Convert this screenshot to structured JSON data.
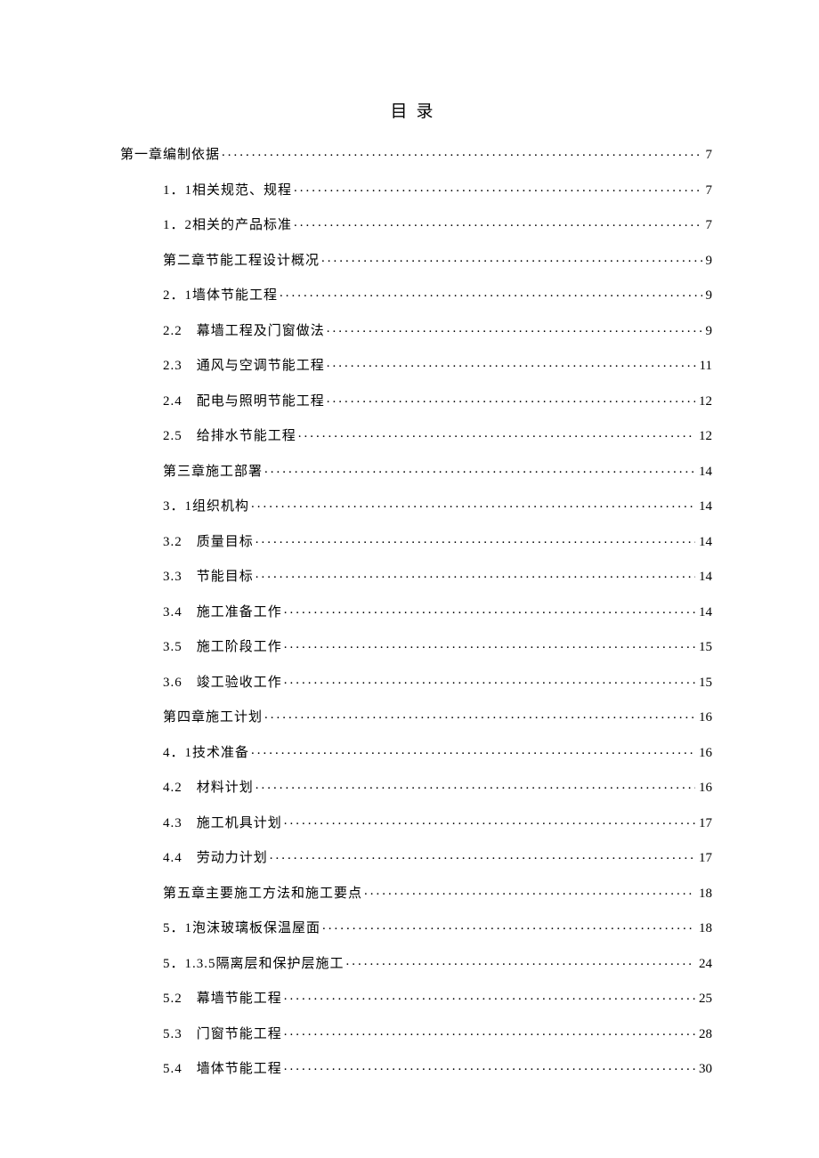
{
  "title": "目录",
  "toc": [
    {
      "level": 0,
      "label": "第一章编制依据",
      "page": "7"
    },
    {
      "level": 1,
      "label": "1．1相关规范、规程",
      "page": "7"
    },
    {
      "level": 1,
      "label": "1．2相关的产品标准",
      "page": "7"
    },
    {
      "level": 1,
      "label": "第二章节能工程设计概况",
      "page": "9"
    },
    {
      "level": 1,
      "label": "2．1墙体节能工程",
      "page": "9"
    },
    {
      "level": 1,
      "label": "2.2　幕墙工程及门窗做法",
      "page": "9"
    },
    {
      "level": 1,
      "label": "2.3　通风与空调节能工程",
      "page": "11"
    },
    {
      "level": 1,
      "label": "2.4　配电与照明节能工程",
      "page": "12"
    },
    {
      "level": 1,
      "label": "2.5　给排水节能工程",
      "page": "12"
    },
    {
      "level": 1,
      "label": "第三章施工部署",
      "page": "14"
    },
    {
      "level": 1,
      "label": "3．1组织机构",
      "page": "14"
    },
    {
      "level": 1,
      "label": "3.2　质量目标",
      "page": "14"
    },
    {
      "level": 1,
      "label": "3.3　节能目标",
      "page": "14"
    },
    {
      "level": 1,
      "label": "3.4　施工准备工作",
      "page": "14"
    },
    {
      "level": 1,
      "label": "3.5　施工阶段工作",
      "page": "15"
    },
    {
      "level": 1,
      "label": "3.6　竣工验收工作",
      "page": "15"
    },
    {
      "level": 1,
      "label": "第四章施工计划",
      "page": "16"
    },
    {
      "level": 1,
      "label": "4．1技术准备",
      "page": "16"
    },
    {
      "level": 1,
      "label": "4.2　材料计划",
      "page": "16"
    },
    {
      "level": 1,
      "label": "4.3　施工机具计划",
      "page": "17"
    },
    {
      "level": 1,
      "label": "4.4　劳动力计划",
      "page": "17"
    },
    {
      "level": 1,
      "label": "第五章主要施工方法和施工要点",
      "page": "18"
    },
    {
      "level": 1,
      "label": "5．1泡沫玻璃板保温屋面",
      "page": "18"
    },
    {
      "level": 1,
      "label": "5．1.3.5隔离层和保护层施工",
      "page": "24"
    },
    {
      "level": 1,
      "label": "5.2　幕墙节能工程",
      "page": "25"
    },
    {
      "level": 1,
      "label": "5.3　门窗节能工程",
      "page": "28"
    },
    {
      "level": 1,
      "label": "5.4　墙体节能工程",
      "page": "30"
    }
  ]
}
